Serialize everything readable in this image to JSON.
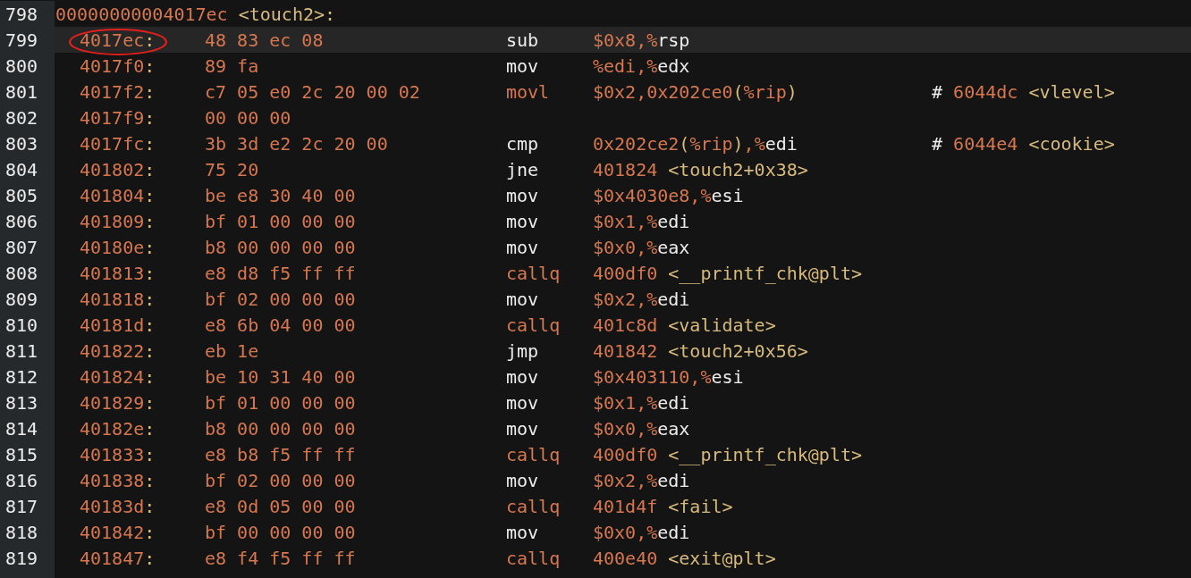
{
  "lines": [
    {
      "kind": "label",
      "line": "798",
      "parts": [
        {
          "text": "00000000004017ec",
          "kind": "num"
        },
        {
          "text": " <touch2>:",
          "kind": "sym"
        }
      ],
      "current": false
    },
    {
      "kind": "instr",
      "line": "799",
      "address": "4017ec:",
      "bytes": "48 83 ec 08",
      "mnemonic": {
        "text": "sub",
        "kind": "plain"
      },
      "operands": [
        {
          "text": "$0x8,%",
          "kind": "num"
        },
        {
          "text": "rsp",
          "kind": "plain"
        }
      ],
      "current": true,
      "circled": true
    },
    {
      "kind": "instr",
      "line": "800",
      "address": "4017f0:",
      "bytes": "89 fa",
      "mnemonic": {
        "text": "mov",
        "kind": "plain"
      },
      "operands": [
        {
          "text": "%edi,%",
          "kind": "num"
        },
        {
          "text": "edx",
          "kind": "plain"
        }
      ],
      "current": false,
      "circled": false
    },
    {
      "kind": "instr",
      "line": "801",
      "address": "4017f2:",
      "bytes": "c7 05 e0 2c 20 00 02",
      "mnemonic": {
        "text": "movl",
        "kind": "num"
      },
      "operands": [
        {
          "text": "$0x2,0x202ce0",
          "kind": "num"
        },
        {
          "text": "(",
          "kind": "sym"
        },
        {
          "text": "%rip",
          "kind": "num"
        },
        {
          "text": ")",
          "kind": "sym"
        }
      ],
      "comment": [
        {
          "text": "#",
          "kind": "plain"
        },
        {
          "text": " 6044dc",
          "kind": "num"
        },
        {
          "text": " <vlevel>",
          "kind": "sym"
        }
      ],
      "current": false,
      "circled": false
    },
    {
      "kind": "instr",
      "line": "802",
      "address": "4017f9:",
      "bytes": "00 00 00",
      "current": false,
      "circled": false
    },
    {
      "kind": "instr",
      "line": "803",
      "address": "4017fc:",
      "bytes": "3b 3d e2 2c 20 00",
      "mnemonic": {
        "text": "cmp",
        "kind": "plain"
      },
      "operands": [
        {
          "text": "0x202ce2",
          "kind": "num"
        },
        {
          "text": "(",
          "kind": "sym"
        },
        {
          "text": "%rip",
          "kind": "num"
        },
        {
          "text": ")",
          "kind": "sym"
        },
        {
          "text": ",%",
          "kind": "num"
        },
        {
          "text": "edi",
          "kind": "plain"
        }
      ],
      "comment": [
        {
          "text": "#",
          "kind": "plain"
        },
        {
          "text": " 6044e4",
          "kind": "num"
        },
        {
          "text": " <cookie>",
          "kind": "sym"
        }
      ],
      "current": false,
      "circled": false
    },
    {
      "kind": "instr",
      "line": "804",
      "address": "401802:",
      "bytes": "75 20",
      "mnemonic": {
        "text": "jne",
        "kind": "plain"
      },
      "operands": [
        {
          "text": "401824",
          "kind": "num"
        },
        {
          "text": " <touch2+0x38>",
          "kind": "sym"
        }
      ],
      "current": false,
      "circled": false
    },
    {
      "kind": "instr",
      "line": "805",
      "address": "401804:",
      "bytes": "be e8 30 40 00",
      "mnemonic": {
        "text": "mov",
        "kind": "plain"
      },
      "operands": [
        {
          "text": "$0x4030e8,%",
          "kind": "num"
        },
        {
          "text": "esi",
          "kind": "plain"
        }
      ],
      "current": false,
      "circled": false
    },
    {
      "kind": "instr",
      "line": "806",
      "address": "401809:",
      "bytes": "bf 01 00 00 00",
      "mnemonic": {
        "text": "mov",
        "kind": "plain"
      },
      "operands": [
        {
          "text": "$0x1,%",
          "kind": "num"
        },
        {
          "text": "edi",
          "kind": "plain"
        }
      ],
      "current": false,
      "circled": false
    },
    {
      "kind": "instr",
      "line": "807",
      "address": "40180e:",
      "bytes": "b8 00 00 00 00",
      "mnemonic": {
        "text": "mov",
        "kind": "plain"
      },
      "operands": [
        {
          "text": "$0x0,%",
          "kind": "num"
        },
        {
          "text": "eax",
          "kind": "plain"
        }
      ],
      "current": false,
      "circled": false
    },
    {
      "kind": "instr",
      "line": "808",
      "address": "401813:",
      "bytes": "e8 d8 f5 ff ff",
      "mnemonic": {
        "text": "callq",
        "kind": "num"
      },
      "operands": [
        {
          "text": "400df0",
          "kind": "num"
        },
        {
          "text": " <__printf_chk@plt>",
          "kind": "sym"
        }
      ],
      "current": false,
      "circled": false
    },
    {
      "kind": "instr",
      "line": "809",
      "address": "401818:",
      "bytes": "bf 02 00 00 00",
      "mnemonic": {
        "text": "mov",
        "kind": "plain"
      },
      "operands": [
        {
          "text": "$0x2,%",
          "kind": "num"
        },
        {
          "text": "edi",
          "kind": "plain"
        }
      ],
      "current": false,
      "circled": false
    },
    {
      "kind": "instr",
      "line": "810",
      "address": "40181d:",
      "bytes": "e8 6b 04 00 00",
      "mnemonic": {
        "text": "callq",
        "kind": "num"
      },
      "operands": [
        {
          "text": "401c8d",
          "kind": "num"
        },
        {
          "text": " <validate>",
          "kind": "sym"
        }
      ],
      "current": false,
      "circled": false
    },
    {
      "kind": "instr",
      "line": "811",
      "address": "401822:",
      "bytes": "eb 1e",
      "mnemonic": {
        "text": "jmp",
        "kind": "plain"
      },
      "operands": [
        {
          "text": "401842",
          "kind": "num"
        },
        {
          "text": " <touch2+0x56>",
          "kind": "sym"
        }
      ],
      "current": false,
      "circled": false
    },
    {
      "kind": "instr",
      "line": "812",
      "address": "401824:",
      "bytes": "be 10 31 40 00",
      "mnemonic": {
        "text": "mov",
        "kind": "plain"
      },
      "operands": [
        {
          "text": "$0x403110,%",
          "kind": "num"
        },
        {
          "text": "esi",
          "kind": "plain"
        }
      ],
      "current": false,
      "circled": false
    },
    {
      "kind": "instr",
      "line": "813",
      "address": "401829:",
      "bytes": "bf 01 00 00 00",
      "mnemonic": {
        "text": "mov",
        "kind": "plain"
      },
      "operands": [
        {
          "text": "$0x1,%",
          "kind": "num"
        },
        {
          "text": "edi",
          "kind": "plain"
        }
      ],
      "current": false,
      "circled": false
    },
    {
      "kind": "instr",
      "line": "814",
      "address": "40182e:",
      "bytes": "b8 00 00 00 00",
      "mnemonic": {
        "text": "mov",
        "kind": "plain"
      },
      "operands": [
        {
          "text": "$0x0,%",
          "kind": "num"
        },
        {
          "text": "eax",
          "kind": "plain"
        }
      ],
      "current": false,
      "circled": false
    },
    {
      "kind": "instr",
      "line": "815",
      "address": "401833:",
      "bytes": "e8 b8 f5 ff ff",
      "mnemonic": {
        "text": "callq",
        "kind": "num"
      },
      "operands": [
        {
          "text": "400df0",
          "kind": "num"
        },
        {
          "text": " <__printf_chk@plt>",
          "kind": "sym"
        }
      ],
      "current": false,
      "circled": false
    },
    {
      "kind": "instr",
      "line": "816",
      "address": "401838:",
      "bytes": "bf 02 00 00 00",
      "mnemonic": {
        "text": "mov",
        "kind": "plain"
      },
      "operands": [
        {
          "text": "$0x2,%",
          "kind": "num"
        },
        {
          "text": "edi",
          "kind": "plain"
        }
      ],
      "current": false,
      "circled": false
    },
    {
      "kind": "instr",
      "line": "817",
      "address": "40183d:",
      "bytes": "e8 0d 05 00 00",
      "mnemonic": {
        "text": "callq",
        "kind": "num"
      },
      "operands": [
        {
          "text": "401d4f",
          "kind": "num"
        },
        {
          "text": " <fail>",
          "kind": "sym"
        }
      ],
      "current": false,
      "circled": false
    },
    {
      "kind": "instr",
      "line": "818",
      "address": "401842:",
      "bytes": "bf 00 00 00 00",
      "mnemonic": {
        "text": "mov",
        "kind": "plain"
      },
      "operands": [
        {
          "text": "$0x0,%",
          "kind": "num"
        },
        {
          "text": "edi",
          "kind": "plain"
        }
      ],
      "current": false,
      "circled": false
    },
    {
      "kind": "instr",
      "line": "819",
      "address": "401847:",
      "bytes": "e8 f4 f5 ff ff",
      "mnemonic": {
        "text": "callq",
        "kind": "num"
      },
      "operands": [
        {
          "text": "400e40",
          "kind": "num"
        },
        {
          "text": " <exit@plt>",
          "kind": "sym"
        }
      ],
      "current": false,
      "circled": false
    }
  ]
}
